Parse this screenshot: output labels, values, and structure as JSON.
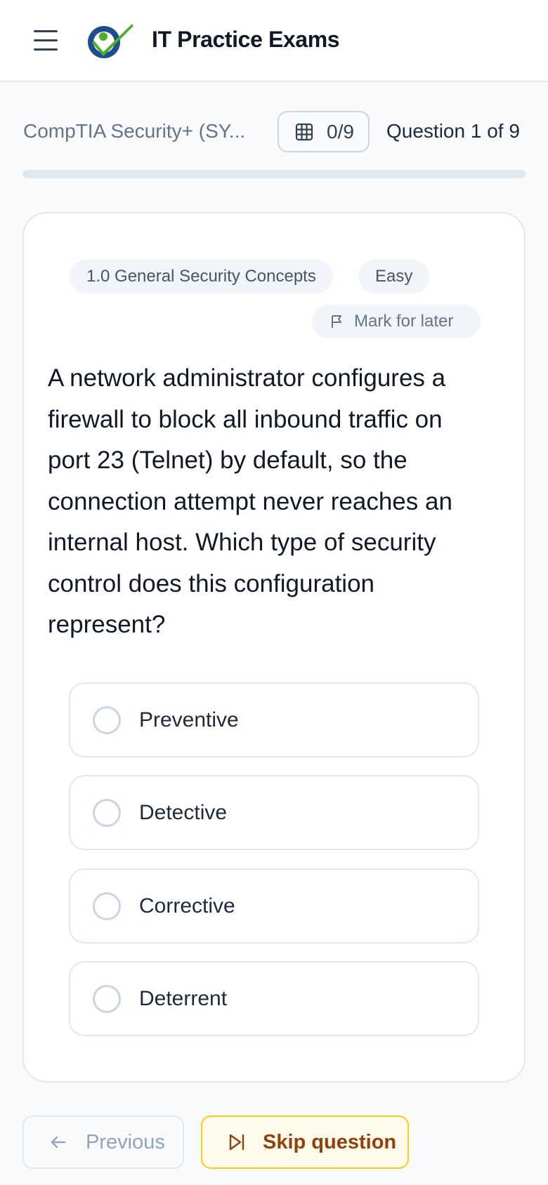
{
  "header": {
    "title": "IT Practice Exams",
    "menu_icon": "hamburger-menu-icon",
    "logo_icon": "checkmark-figure-logo"
  },
  "progress": {
    "exam_name": "CompTIA Security+ (SY...",
    "answered_count": "0/9",
    "question_counter": "Question 1 of 9",
    "fraction_complete": 0,
    "grid_icon": "grid-icon"
  },
  "question": {
    "domain_tag": "1.0 General Security Concepts",
    "difficulty_tag": "Easy",
    "mark_for_later_label": "Mark for later",
    "flag_icon": "flag-icon",
    "text": "A network administrator configures a firewall to block all inbound traffic on port 23 (Telnet) by default, so the connection attempt never reaches an internal host. Which type of security control does this configuration represent?",
    "options": [
      {
        "label": "Preventive"
      },
      {
        "label": "Detective"
      },
      {
        "label": "Corrective"
      },
      {
        "label": "Deterrent"
      }
    ]
  },
  "footer": {
    "previous_label": "Previous",
    "skip_label": "Skip question",
    "previous_icon": "arrow-left-icon",
    "skip_icon": "skip-forward-icon"
  },
  "colors": {
    "accent_blue": "#1f4e8c",
    "accent_green": "#4caf2a",
    "skip_border": "#facc15",
    "skip_text": "#92400e"
  }
}
